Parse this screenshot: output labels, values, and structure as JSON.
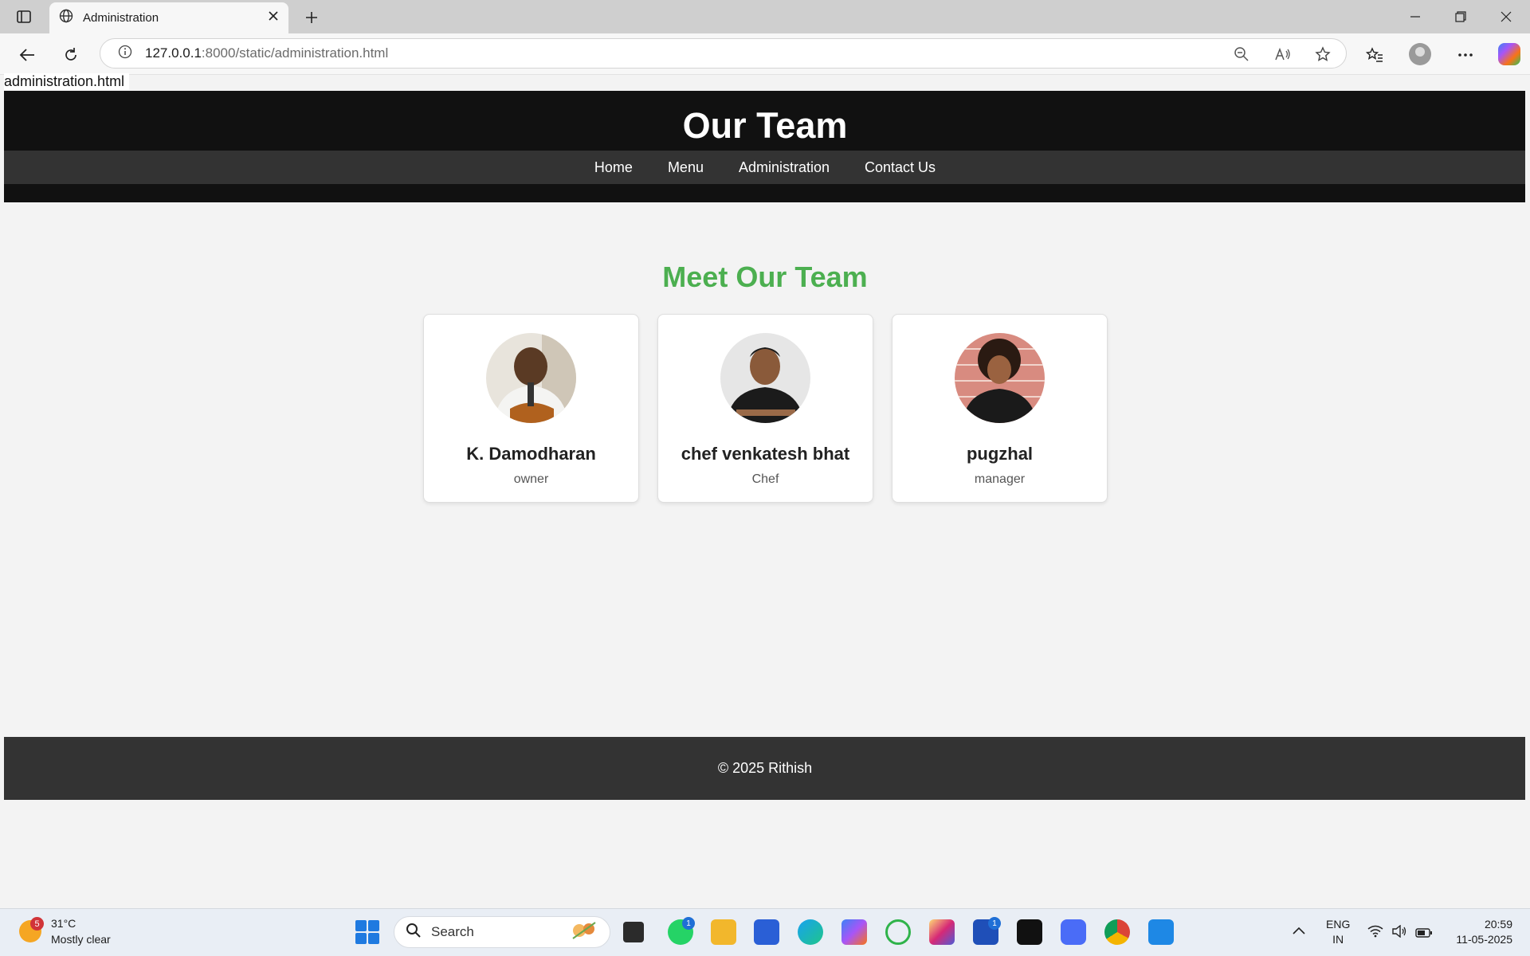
{
  "browser": {
    "tab_title": "Administration",
    "url_host": "127.0.0.1",
    "url_rest": ":8000/static/administration.html"
  },
  "page": {
    "file_label": "administration.html",
    "header_title": "Our Team",
    "nav": [
      "Home",
      "Menu",
      "Administration",
      "Contact Us"
    ],
    "section_heading": "Meet Our Team",
    "team": [
      {
        "name": "K. Damodharan",
        "role": "owner"
      },
      {
        "name": "chef venkatesh bhat",
        "role": "Chef"
      },
      {
        "name": "pugzhal",
        "role": "manager"
      }
    ],
    "footer": "© 2025 Rithish"
  },
  "taskbar": {
    "weather_badge": "5",
    "temperature": "31°C",
    "condition": "Mostly clear",
    "search_placeholder": "Search",
    "whatsapp_badge": "1",
    "l_badge": "1",
    "lang_line1": "ENG",
    "lang_line2": "IN",
    "time": "20:59",
    "date": "11-05-2025"
  },
  "colors": {
    "accent_green": "#4caf50",
    "header_bg": "#111111",
    "nav_bg": "#333333"
  }
}
